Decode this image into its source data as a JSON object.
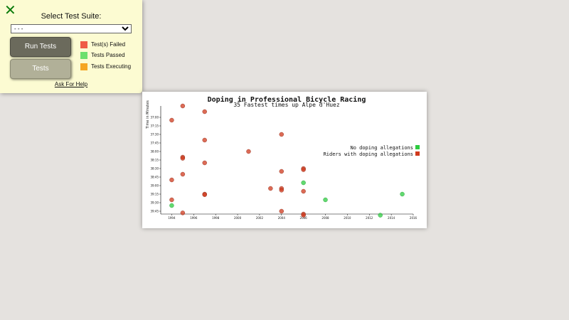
{
  "panel": {
    "close_icon": "close-x-icon",
    "title": "Select Test Suite:",
    "select_value": "- - -",
    "run_label": "Run Tests",
    "tests_label": "Tests",
    "legend": [
      {
        "label": "Test(s) Failed",
        "color": "#ef5b45"
      },
      {
        "label": "Tests Passed",
        "color": "#6ddf6d"
      },
      {
        "label": "Tests Executing",
        "color": "#f5a623"
      }
    ],
    "help_label": "Ask For Help"
  },
  "chart_data": {
    "type": "scatter",
    "title": "Doping in Professional Bicycle Racing",
    "subtitle": "35 Fastest times up Alpe d'Huez",
    "xlabel": "",
    "ylabel": "Time in Minutes",
    "xlim": [
      1993,
      2016
    ],
    "ylim": [
      "36:40",
      "39:50"
    ],
    "x_ticks": [
      "1994",
      "1996",
      "1998",
      "2000",
      "2002",
      "2004",
      "2006",
      "2008",
      "2010",
      "2012",
      "2014",
      "2016"
    ],
    "y_ticks": [
      "37:00",
      "37:15",
      "37:30",
      "37:45",
      "38:00",
      "38:15",
      "38:30",
      "38:45",
      "39:00",
      "39:15",
      "39:30",
      "39:45"
    ],
    "legend_position": "right",
    "colors": {
      "no_doping": "#2ecc40",
      "doping": "#d0391d"
    },
    "series": [
      {
        "name": "No doping allegations",
        "points": [
          {
            "year": 1994,
            "time": "39:35"
          },
          {
            "year": 2006,
            "time": "38:55"
          },
          {
            "year": 2008,
            "time": "39:25"
          },
          {
            "year": 2013,
            "time": "39:52"
          },
          {
            "year": 2015,
            "time": "39:15"
          }
        ]
      },
      {
        "name": "Riders with doping allegations",
        "points": [
          {
            "year": 1994,
            "time": "37:05"
          },
          {
            "year": 1994,
            "time": "38:50"
          },
          {
            "year": 1994,
            "time": "39:25"
          },
          {
            "year": 1995,
            "time": "36:40"
          },
          {
            "year": 1995,
            "time": "38:10"
          },
          {
            "year": 1995,
            "time": "38:12"
          },
          {
            "year": 1995,
            "time": "38:40"
          },
          {
            "year": 1995,
            "time": "39:48"
          },
          {
            "year": 1997,
            "time": "36:50"
          },
          {
            "year": 1997,
            "time": "37:40"
          },
          {
            "year": 1997,
            "time": "38:20"
          },
          {
            "year": 1997,
            "time": "39:15"
          },
          {
            "year": 1997,
            "time": "39:16"
          },
          {
            "year": 2001,
            "time": "38:00"
          },
          {
            "year": 2003,
            "time": "39:05"
          },
          {
            "year": 2004,
            "time": "37:30"
          },
          {
            "year": 2004,
            "time": "38:35"
          },
          {
            "year": 2004,
            "time": "39:05"
          },
          {
            "year": 2004,
            "time": "39:08"
          },
          {
            "year": 2004,
            "time": "39:45"
          },
          {
            "year": 2006,
            "time": "38:30"
          },
          {
            "year": 2006,
            "time": "38:32"
          },
          {
            "year": 2006,
            "time": "39:10"
          },
          {
            "year": 2006,
            "time": "39:50"
          },
          {
            "year": 2006,
            "time": "39:52"
          }
        ]
      }
    ]
  }
}
